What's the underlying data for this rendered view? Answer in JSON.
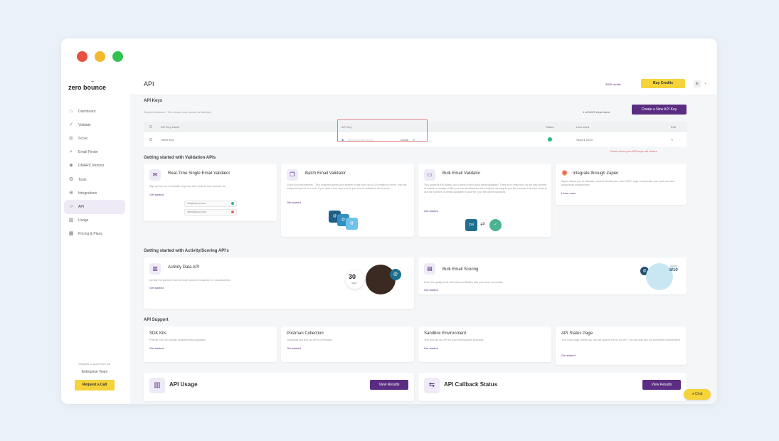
{
  "logo": {
    "text": "zero bounce",
    "mark": "~"
  },
  "sidebar": {
    "items": [
      {
        "label": "Dashboard",
        "icon": "⌂"
      },
      {
        "label": "Validate",
        "icon": "✓"
      },
      {
        "label": "Score",
        "icon": "◎"
      },
      {
        "label": "Email Finder",
        "icon": "⌕"
      },
      {
        "label": "DMARC Monitor",
        "icon": "◈"
      },
      {
        "label": "Tools",
        "icon": "⚙"
      },
      {
        "label": "Integrations",
        "icon": "⊕"
      },
      {
        "label": "API",
        "icon": "‹›"
      },
      {
        "label": "Usage",
        "icon": "▥"
      },
      {
        "label": "Pricing & Plans",
        "icon": "▦"
      }
    ],
    "promo": {
      "text": "Request a quote from our",
      "team": "Enterprise Team",
      "button": "Request a Call"
    }
  },
  "header": {
    "title": "API",
    "credits": "5305 credits",
    "buy_label": "Buy Credits",
    "avatar": "E"
  },
  "api_keys": {
    "title": "API Keys",
    "note": "Expired selected - The chosen key cannot be deleted",
    "count": "1 of 5 API Keys Used",
    "create_label": "Create a New API Key",
    "columns": [
      "API Key Name",
      "API Key",
      "Status",
      "Last Used",
      "Edit"
    ],
    "rows": [
      {
        "name": "Home Key",
        "key": "••••••••••••••••••••",
        "reveal": "reveal",
        "last_used": "Sep/21 2023"
      }
    ],
    "reset": "Reset show your API keys will others"
  },
  "validation": {
    "title": "Getting started with Validation APIs",
    "cards": [
      {
        "title": "Real-Time Single Email Validator",
        "desc": "Sign up form for immediate response with email to and returned out",
        "link": "Get started",
        "inputs": [
          "info@seend.com",
          "admin@yout.com"
        ]
      },
      {
        "title": "Batch Email Validator",
        "desc": "Good for small batches - This endpoint allows your system to ask then up to 100 emails at a time. Use this endpoint if you're in a rush. If you want a fast way to end, you should default for all services.",
        "link": "Get started"
      },
      {
        "title": "Bulk Email Validator",
        "desc": "This powerful API allows you to send a file to bulk email validation. There is no restriction on the size number of emails or number of files you can send/access the endpoint. As long as you file exceeds it and you want to use the number of credits available in your file, your file will be accepted.",
        "link": "Get started"
      },
      {
        "title": "Integrate through Zapier",
        "desc": "Zapier allows you to instantly connect ZeroBounce with 6,000+ apps to automate your work and find productivity superpowers.",
        "link": "Learn more"
      }
    ]
  },
  "activity": {
    "title": "Getting started with Activity/Scoring API's",
    "cards": [
      {
        "title": "Activity Data API",
        "desc": "Identify the last time that an email, opened, forwarded, or unsubscribed.",
        "link": "Get started",
        "badge": "30",
        "badge_sub": "days"
      },
      {
        "title": "Bulk Email Scoring",
        "desc": "Enter the quality level with data and finalize with your send out emails.",
        "link": "Get started",
        "score": "8/10",
        "score_label": "Score"
      }
    ]
  },
  "support": {
    "title": "API Support",
    "cards": [
      {
        "title": "SDK Kits",
        "desc": "Prebuilt SDK for popular programming languages",
        "link": "Get started"
      },
      {
        "title": "Postman Collection",
        "desc": "Download and test our API's in Postman",
        "link": "Get started"
      },
      {
        "title": "Sandbox Environment",
        "desc": "Test and use our API for your development purposes",
        "link": "Get started"
      },
      {
        "title": "API Status Page",
        "desc": "This is the page where you can see uptime live for our API. You can also see our scheduled maintenance.",
        "link": "Get started"
      }
    ]
  },
  "bottom": {
    "usage": {
      "title": "API Usage",
      "button": "View Results"
    },
    "callback": {
      "title": "API Callback Status",
      "button": "View Results"
    }
  },
  "chat": {
    "label": "Chat"
  },
  "colors": {
    "accent": "#5a2d82",
    "yellow": "#f5d339",
    "status": "#28b77c"
  }
}
